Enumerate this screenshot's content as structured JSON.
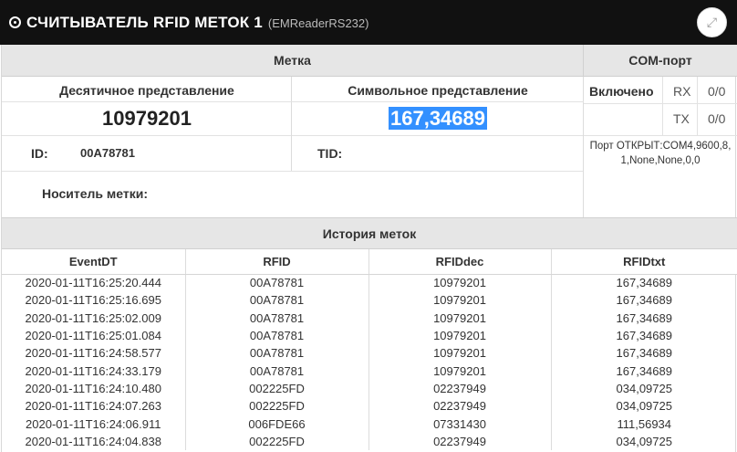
{
  "header": {
    "title": "СЧИТЫВАТЕЛЬ RFID МЕТОК 1",
    "subtitle": "(EMReaderRS232)"
  },
  "tag": {
    "section_title": "Метка",
    "decimal_label": "Десятичное представление",
    "symbolic_label": "Символьное представление",
    "decimal_value": "10979201",
    "symbolic_value": "167,34689",
    "id_label": "ID:",
    "id_value": "00A78781",
    "tid_label": "TID:",
    "tid_value": "",
    "carrier_label": "Носитель метки:",
    "carrier_value": ""
  },
  "com": {
    "section_title": "COM-порт",
    "enabled_label": "Включено",
    "rx_label": "RX",
    "rx_value": "0/0",
    "tx_label": "TX",
    "tx_value": "0/0",
    "port_status": "Порт ОТКРЫТ:COM4,9600,8,1,None,None,0,0"
  },
  "history": {
    "section_title": "История меток",
    "columns": [
      "EventDT",
      "RFID",
      "RFIDdec",
      "RFIDtxt"
    ],
    "rows": [
      [
        "2020-01-11T16:25:20.444",
        "00A78781",
        "10979201",
        "167,34689"
      ],
      [
        "2020-01-11T16:25:16.695",
        "00A78781",
        "10979201",
        "167,34689"
      ],
      [
        "2020-01-11T16:25:02.009",
        "00A78781",
        "10979201",
        "167,34689"
      ],
      [
        "2020-01-11T16:25:01.084",
        "00A78781",
        "10979201",
        "167,34689"
      ],
      [
        "2020-01-11T16:24:58.577",
        "00A78781",
        "10979201",
        "167,34689"
      ],
      [
        "2020-01-11T16:24:33.179",
        "00A78781",
        "10979201",
        "167,34689"
      ],
      [
        "2020-01-11T16:24:10.480",
        "002225FD",
        "02237949",
        "034,09725"
      ],
      [
        "2020-01-11T16:24:07.263",
        "002225FD",
        "02237949",
        "034,09725"
      ],
      [
        "2020-01-11T16:24:06.911",
        "006FDE66",
        "07331430",
        "111,56934"
      ],
      [
        "2020-01-11T16:24:04.838",
        "002225FD",
        "02237949",
        "034,09725"
      ]
    ]
  },
  "icons": {
    "title_icon": "clock-icon",
    "expand_icon": "expand-icon"
  },
  "colors": {
    "titlebar_bg": "#111111",
    "selection_bg": "#3390ff",
    "section_header_bg": "#e6e6e6"
  }
}
